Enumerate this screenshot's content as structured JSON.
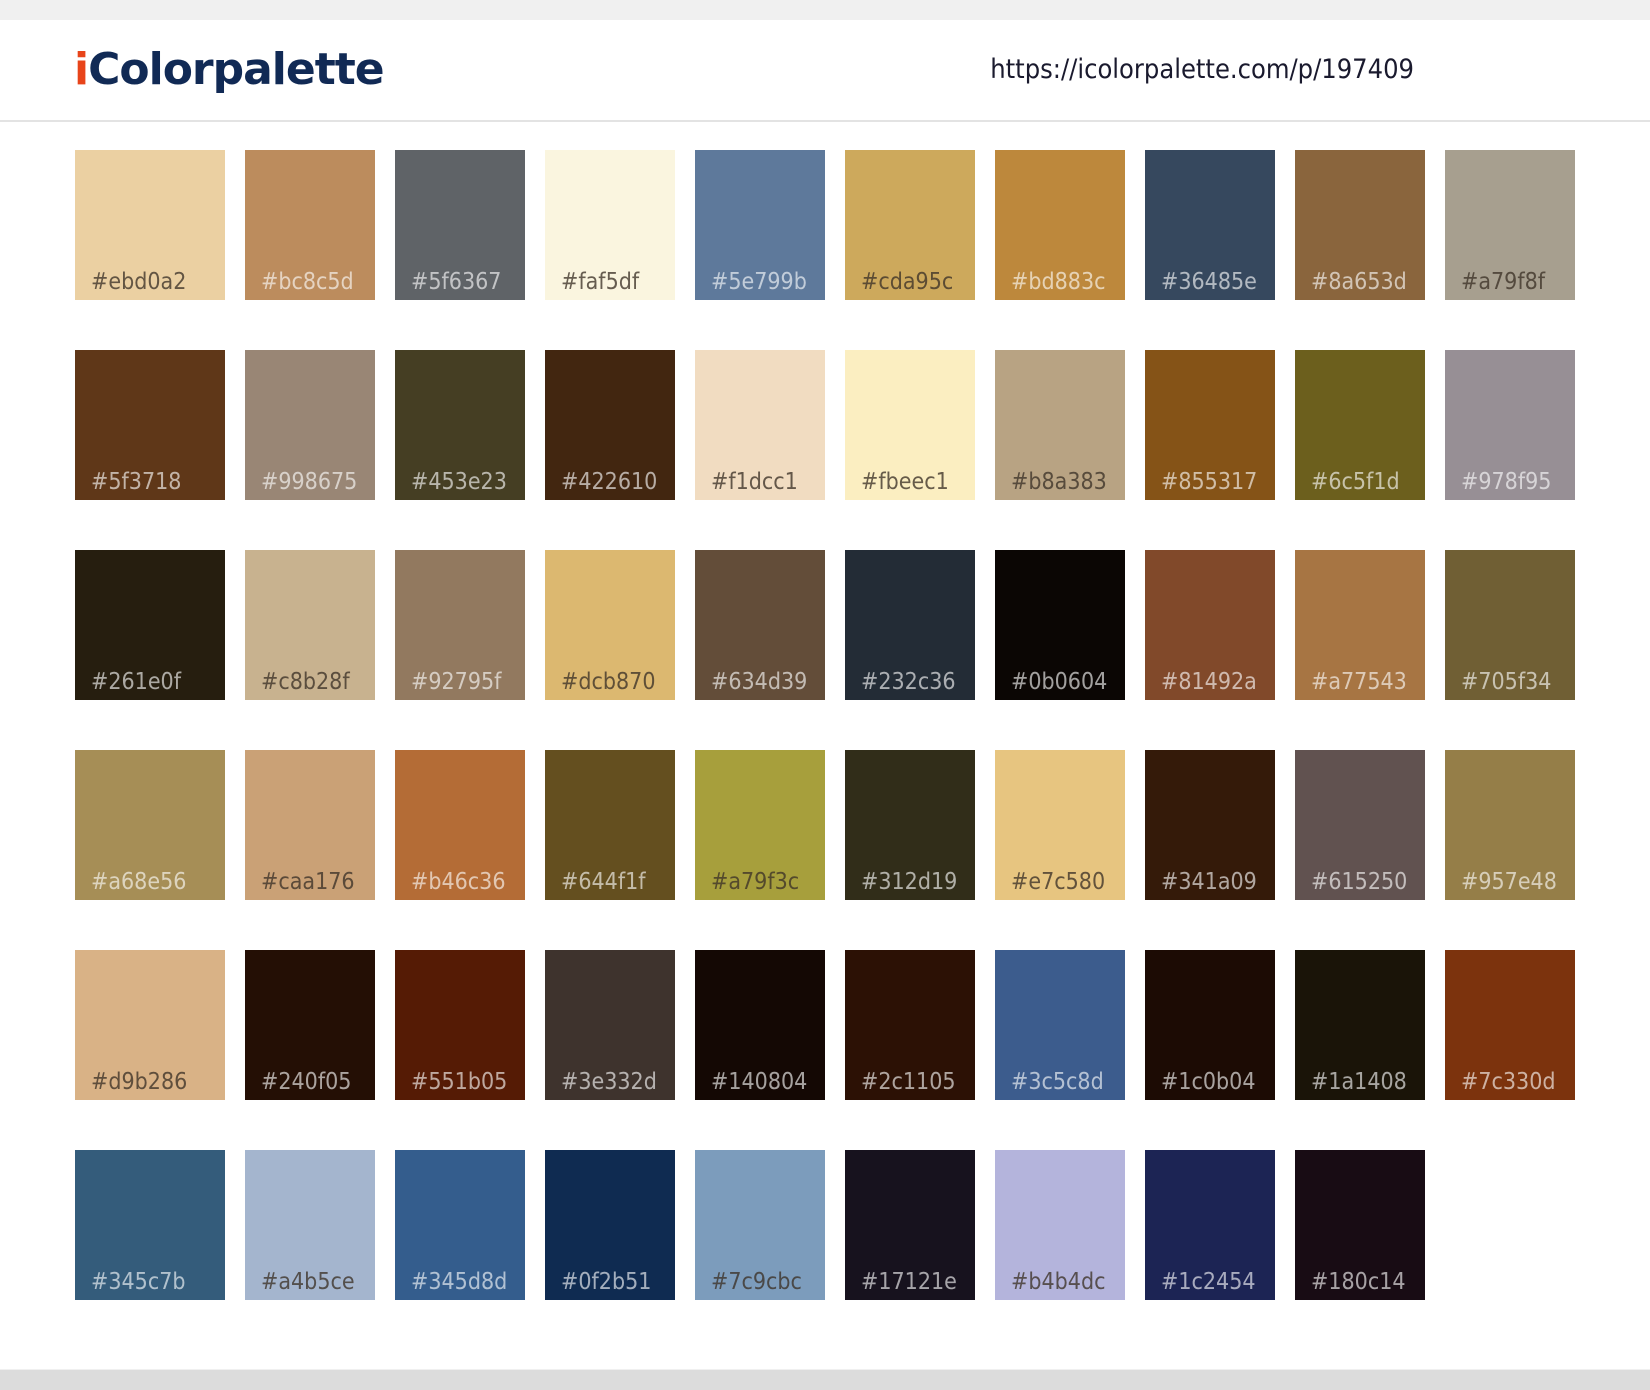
{
  "header": {
    "logo_i": "i",
    "logo_rest": "Colorpalette",
    "url": "https://icolorpalette.com/p/197409"
  },
  "colors": [
    [
      "#ebd0a2",
      "#bc8c5d",
      "#5f6367",
      "#faf5df",
      "#5e799b",
      "#cda95c",
      "#bd883c",
      "#36485e",
      "#8a653d",
      "#a79f8f"
    ],
    [
      "#5f3718",
      "#998675",
      "#453e23",
      "#422610",
      "#f1dcc1",
      "#fbeec1",
      "#b8a383",
      "#855317",
      "#6c5f1d",
      "#978f95"
    ],
    [
      "#261e0f",
      "#c8b28f",
      "#92795f",
      "#dcb870",
      "#634d39",
      "#232c36",
      "#0b0604",
      "#81492a",
      "#a77543",
      "#705f34"
    ],
    [
      "#a68e56",
      "#caa176",
      "#b46c36",
      "#644f1f",
      "#a79f3c",
      "#312d19",
      "#e7c580",
      "#341a09",
      "#615250",
      "#957e48"
    ],
    [
      "#d9b286",
      "#240f05",
      "#551b05",
      "#3e332d",
      "#140804",
      "#2c1105",
      "#3c5c8d",
      "#1c0b04",
      "#1a1408",
      "#7c330d"
    ],
    [
      "#345c7b",
      "#a4b5ce",
      "#345d8d",
      "#0f2b51",
      "#7c9cbc",
      "#17121e",
      "#b4b4dc",
      "#1c2454",
      "#180c14"
    ]
  ]
}
